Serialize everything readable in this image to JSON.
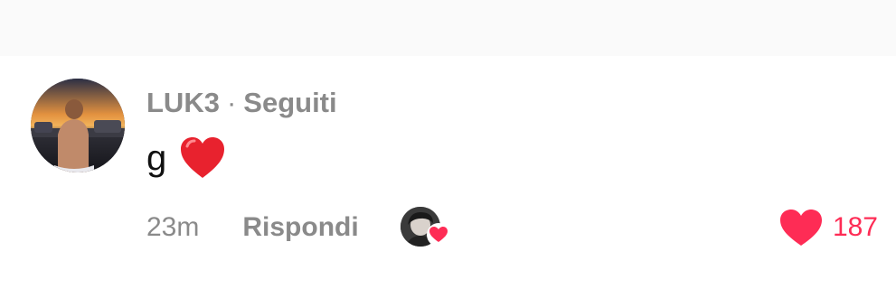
{
  "comment": {
    "username": "LUK3",
    "separator": "·",
    "follow_status": "Seguiti",
    "text": "g",
    "emoji": "red-heart",
    "timestamp": "23m",
    "reply_label": "Rispondi",
    "like_count": "187",
    "creator_liked": true
  },
  "colors": {
    "like_accent": "#fe2c55",
    "meta_gray": "#8a8a8a",
    "text_dark": "#111111",
    "top_band": "#fafafa"
  },
  "icons": {
    "like": "heart-filled-icon",
    "emoji": "red-heart-emoji-icon",
    "creator_like_badge": "heart-badge-icon"
  }
}
